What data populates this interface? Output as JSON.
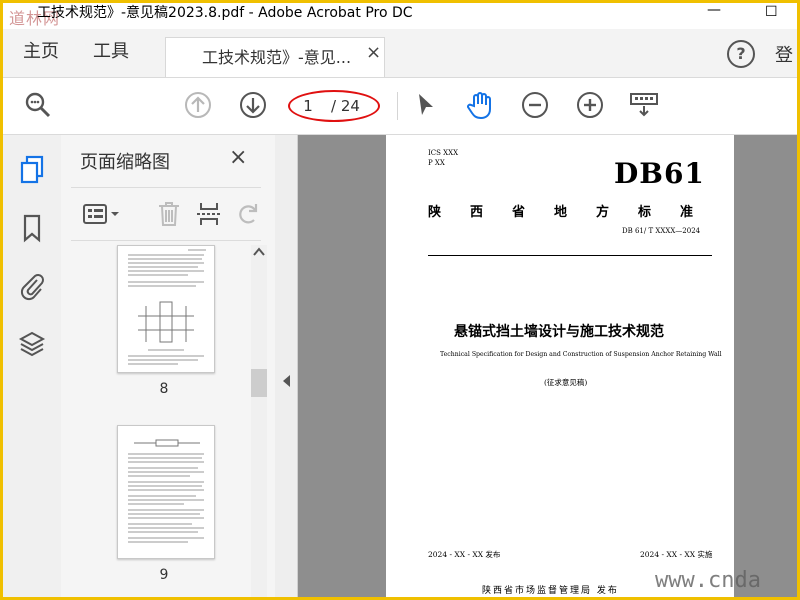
{
  "window": {
    "title": "工技术规范》-意见稿2023.8.pdf - Adobe Acrobat Pro DC",
    "watermark_logo": "道林网",
    "controls": {
      "minimize": "—",
      "maximize": "☐"
    }
  },
  "tabbar": {
    "home_label": "主页",
    "tools_label": "工具",
    "doc_tab_label": "工技术规范》-意见...",
    "doc_tab_close": "×",
    "help_label": "?",
    "login_label": "登"
  },
  "toolbar": {
    "current_page": "1",
    "total_pages": "/ 24",
    "icons": [
      "search-icon",
      "prev-page-icon",
      "next-page-icon",
      "select-cursor-icon",
      "hand-tool-icon",
      "zoom-out-icon",
      "zoom-in-icon",
      "keyboard-icon"
    ],
    "accent": "#1473e6",
    "annotation_color": "#e01010"
  },
  "left_rail": {
    "icons": [
      "pages-icon",
      "bookmark-icon",
      "attachment-icon",
      "layers-icon"
    ]
  },
  "thumbnails_panel": {
    "title": "页面缩略图",
    "close": "×",
    "thumbnails": [
      {
        "label": "8"
      },
      {
        "label": "9"
      }
    ]
  },
  "document": {
    "ics": "ICS XXX",
    "p": "P XX",
    "code": "DB61",
    "provincial_standard": "陕西省地方标准",
    "standard_number": "DB 61/ T XXXX—2024",
    "title_cn": "悬锚式挡土墙设计与施工技术规范",
    "title_en": "Technical Specification for Design and Construction of Suspension Anchor Retaining Wall",
    "draft_note": "(征求意见稿)",
    "issue_date": "2024 - XX - XX 发布",
    "implement_date": "2024 - XX - XX 实施",
    "publisher": "陕西省市场监督管理局 发布"
  },
  "site_watermark": "www.cnda"
}
